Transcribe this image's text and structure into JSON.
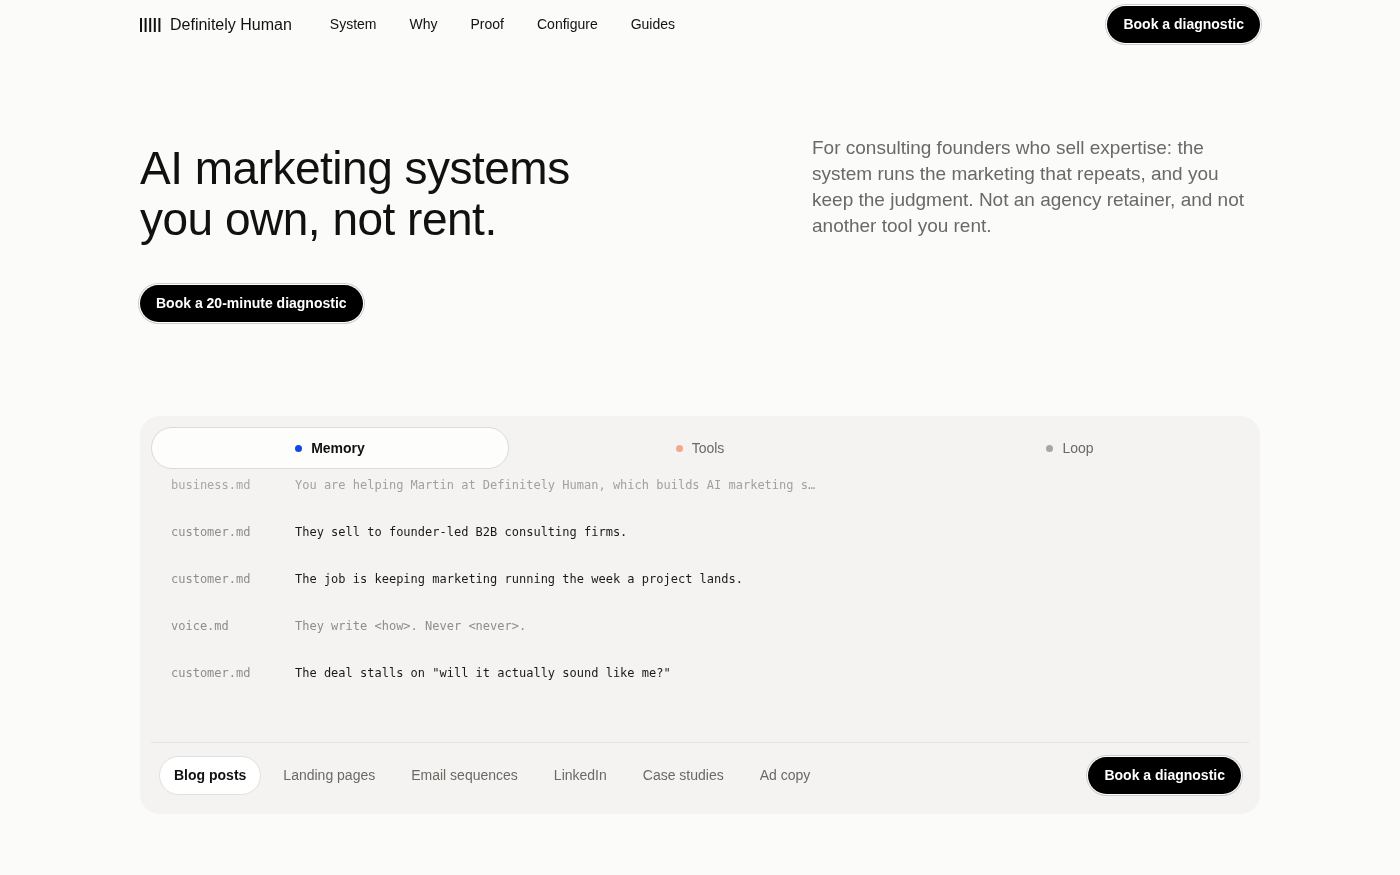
{
  "nav": {
    "logo": "Definitely Human",
    "links": [
      "System",
      "Why",
      "Proof",
      "Configure",
      "Guides"
    ],
    "cta": "Book a diagnostic"
  },
  "hero": {
    "title_lines": [
      "AI marketing systems",
      "you own, not rent."
    ],
    "cta": "Book a 20-minute diagnostic",
    "description": "For consulting founders who sell expertise: the system runs the marketing that repeats, and you keep the judgment. Not an agency retainer, and not another tool you rent."
  },
  "panel": {
    "tabs": [
      {
        "label": "Memory",
        "selected": true,
        "color": "#1447e6"
      },
      {
        "label": "Tools",
        "selected": false,
        "color": "#f4a98a"
      },
      {
        "label": "Loop",
        "selected": false,
        "color": "#a8a6a3"
      }
    ],
    "lines": [
      {
        "file": "business.md",
        "text": "You are helping Martin at Definitely Human, which builds AI marketing s…",
        "muted": true,
        "faded": true
      },
      {
        "file": "customer.md",
        "text": "They sell to founder-led B2B consulting firms.",
        "muted": false,
        "faded": false
      },
      {
        "file": "customer.md",
        "text": "The job is keeping marketing running the week a project lands.",
        "muted": false,
        "faded": false
      },
      {
        "file": "voice.md",
        "text": "They write <how>. Never <never>.",
        "muted": true,
        "faded": false
      },
      {
        "file": "customer.md",
        "text": "The deal stalls on \"will it actually sound like me?\"",
        "muted": false,
        "faded": false
      }
    ],
    "outputs": [
      {
        "label": "Blog posts",
        "selected": true
      },
      {
        "label": "Landing pages",
        "selected": false
      },
      {
        "label": "Email sequences",
        "selected": false
      },
      {
        "label": "LinkedIn",
        "selected": false
      },
      {
        "label": "Case studies",
        "selected": false
      },
      {
        "label": "Ad copy",
        "selected": false
      }
    ],
    "cta": "Book a diagnostic"
  }
}
